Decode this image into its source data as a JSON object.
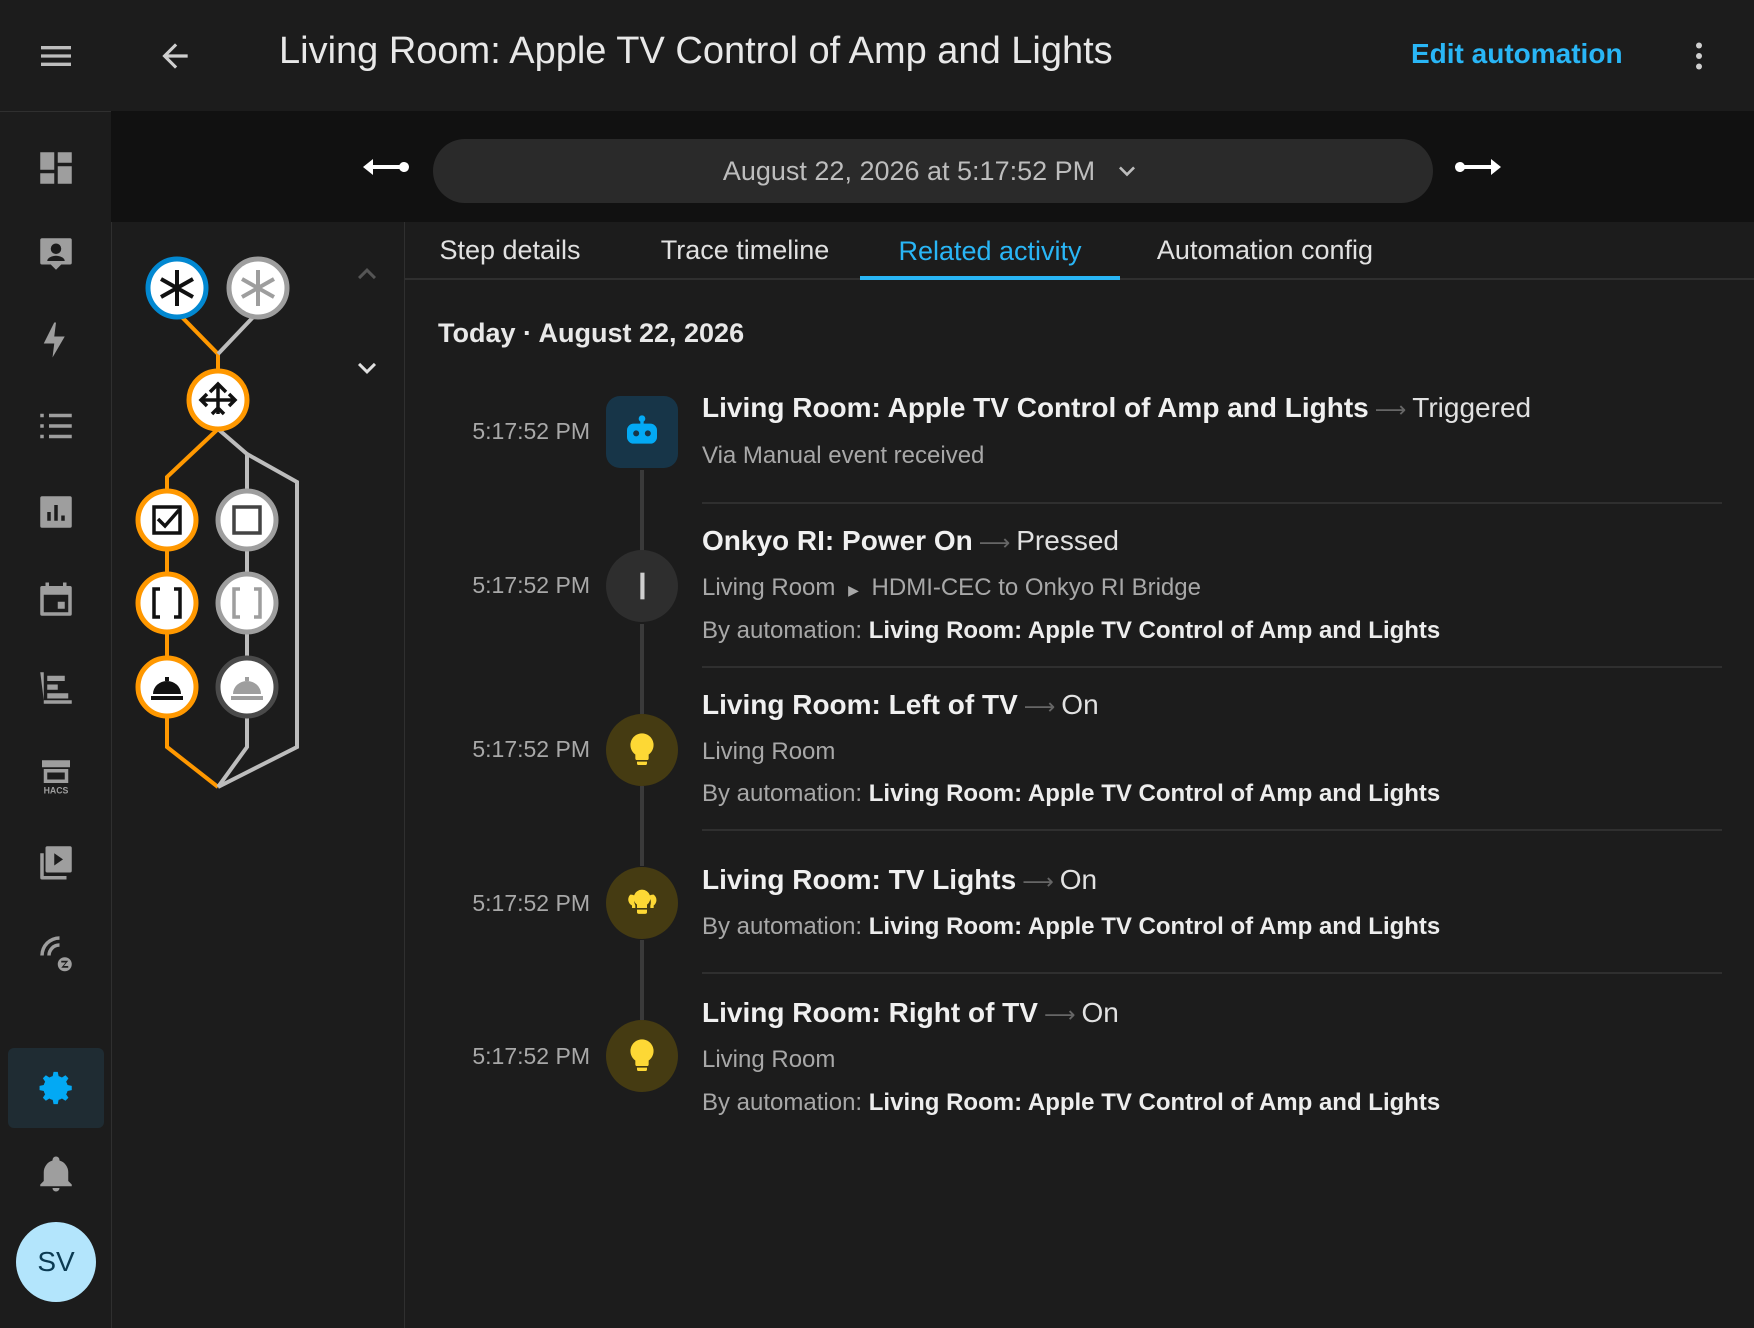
{
  "header": {
    "title": "Living Room: Apple TV Control of Amp and Lights",
    "edit_label": "Edit automation"
  },
  "trace": {
    "selected": "August 22, 2026 at 5:17:52 PM"
  },
  "tabs": [
    {
      "label": "Step details",
      "active": false
    },
    {
      "label": "Trace timeline",
      "active": false
    },
    {
      "label": "Related activity",
      "active": true
    },
    {
      "label": "Automation config",
      "active": false
    }
  ],
  "activity": {
    "day_header": "Today · August 22, 2026",
    "entries": [
      {
        "time": "5:17:52 PM",
        "icon": "robot-icon",
        "name": "Living Room: Apple TV Control of Amp and Lights",
        "state": "Triggered",
        "sub1": "Via Manual event received"
      },
      {
        "time": "5:17:52 PM",
        "icon": "button-icon",
        "name": "Onkyo RI: Power On",
        "state": "Pressed",
        "area": "Living Room",
        "device": "HDMI-CEC to Onkyo RI Bridge",
        "context_label": "By automation:",
        "context_name": "Living Room: Apple TV Control of Amp and Lights"
      },
      {
        "time": "5:17:52 PM",
        "icon": "lightbulb-icon",
        "name": "Living Room: Left of TV",
        "state": "On",
        "area": "Living Room",
        "context_label": "By automation:",
        "context_name": "Living Room: Apple TV Control of Amp and Lights"
      },
      {
        "time": "5:17:52 PM",
        "icon": "lightbulb-group-icon",
        "name": "Living Room: TV Lights",
        "state": "On",
        "context_label": "By automation:",
        "context_name": "Living Room: Apple TV Control of Amp and Lights"
      },
      {
        "time": "5:17:52 PM",
        "icon": "lightbulb-icon",
        "name": "Living Room: Right of TV",
        "state": "On",
        "area": "Living Room",
        "context_label": "By automation:",
        "context_name": "Living Room: Apple TV Control of Amp and Lights"
      }
    ]
  },
  "user": {
    "initials": "SV"
  },
  "colors": {
    "accent": "#03a9f4",
    "trace_active": "#ff9800",
    "trace_inactive": "#bdbdbd",
    "light_on": "#fdd835"
  }
}
